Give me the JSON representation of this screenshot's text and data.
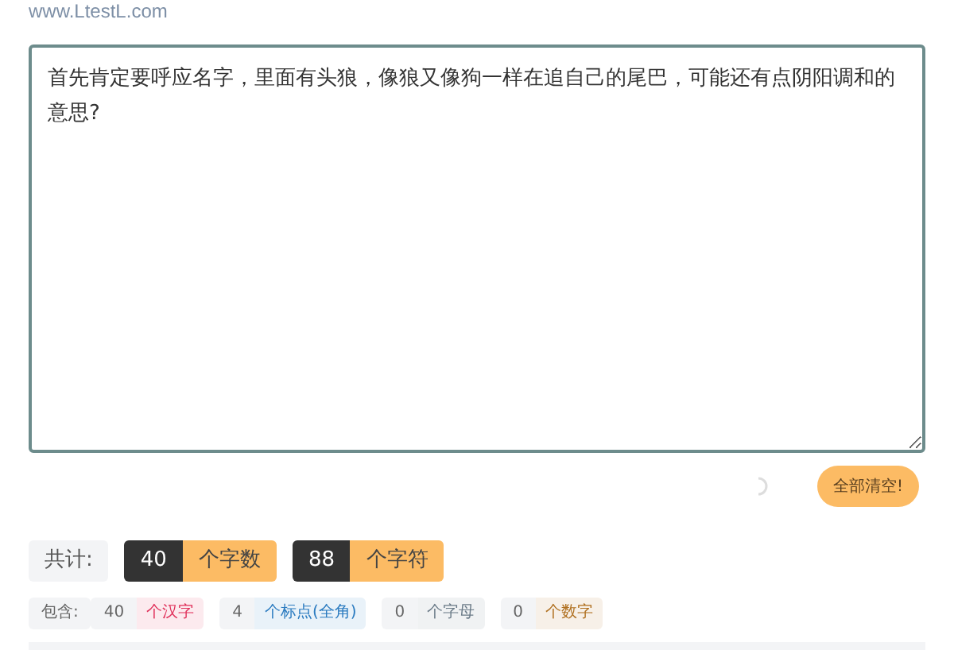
{
  "site": "www.LtestL.com",
  "editor": {
    "value": "首先肯定要呼应名字，里面有头狼，像狼又像狗一样在追自己的尾巴，可能还有点阴阳调和的意思?"
  },
  "clear_button": "全部清空!",
  "totals": {
    "label": "共计:",
    "items": [
      {
        "count": "40",
        "unit": "个字数"
      },
      {
        "count": "88",
        "unit": "个字符"
      }
    ]
  },
  "breakdown": {
    "label": "包含:",
    "items": [
      {
        "count": "40",
        "unit": "个汉字",
        "color": "#e0305a"
      },
      {
        "count": "4",
        "unit": "个标点(全角)",
        "color": "#2b7bc0"
      },
      {
        "count": "0",
        "unit": "个字母",
        "color": "#6b7b88"
      },
      {
        "count": "0",
        "unit": "个数字",
        "color": "#b07020"
      }
    ]
  }
}
